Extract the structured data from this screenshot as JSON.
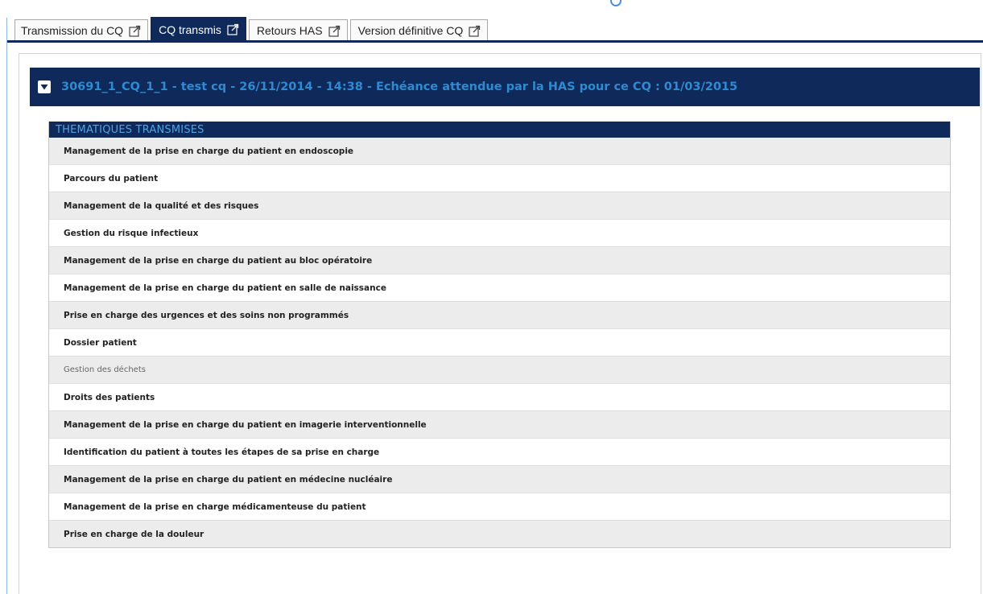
{
  "tabs": [
    {
      "label": "Transmission du CQ",
      "active": false,
      "icon": "external-link-icon"
    },
    {
      "label": "CQ transmis",
      "active": true,
      "icon": "external-link-icon"
    },
    {
      "label": "Retours HAS",
      "active": false,
      "icon": "external-link-icon"
    },
    {
      "label": "Version définitive CQ",
      "active": false,
      "icon": "external-link-icon"
    }
  ],
  "cq": {
    "title": "30691_1_CQ_1_1 - test cq - 26/11/2014 - 14:38 - Echéance attendue par la HAS pour ce CQ : 01/03/2015",
    "toggle_icon": "caret-down-icon"
  },
  "section": {
    "title": "THEMATIQUES TRANSMISES"
  },
  "themes": [
    "Management de la prise en charge du patient en endoscopie",
    "Parcours du patient",
    "Management de la qualité et des risques",
    "Gestion du risque infectieux",
    "Management de la prise en charge du patient au bloc opératoire",
    "Management de la prise en charge du patient en salle de naissance",
    "Prise en charge des urgences et des soins non programmés",
    "Dossier patient",
    "Gestion des déchets",
    "Droits des patients",
    "Management de la prise en charge du patient en imagerie interventionnelle",
    "Identification du patient à toutes les étapes de sa prise en charge",
    "Management de la prise en charge du patient en médecine nucléaire",
    "Management de la prise en charge médicamenteuse du patient",
    "Prise en charge de la douleur"
  ],
  "colors": {
    "navy": "#0f2a5a",
    "title_blue": "#2f8ad1",
    "section_blue": "#4fa3e6",
    "row_alt": "#ececec"
  }
}
